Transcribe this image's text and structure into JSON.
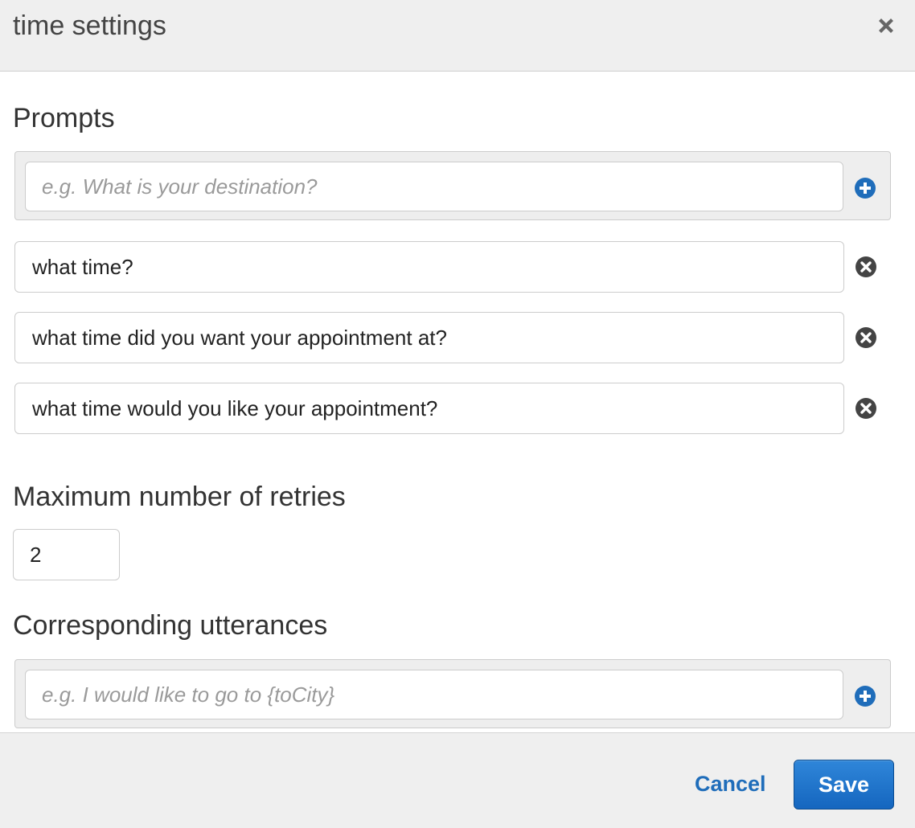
{
  "dialog": {
    "title": "time settings",
    "close_icon": "close-icon"
  },
  "prompts": {
    "heading": "Prompts",
    "new_prompt_placeholder": "e.g. What is your destination?",
    "add_icon": "plus-circle-icon",
    "remove_icon": "x-circle-icon",
    "items": [
      "what time?",
      "what time did you want your appointment at?",
      "what time would you like your appointment?"
    ]
  },
  "retries": {
    "heading": "Maximum number of retries",
    "value": "2"
  },
  "utterances": {
    "heading": "Corresponding utterances",
    "new_utterance_placeholder": "e.g. I would like to go to {toCity}",
    "add_icon": "plus-circle-icon"
  },
  "footer": {
    "cancel_label": "Cancel",
    "save_label": "Save"
  },
  "colors": {
    "accent": "#1f6dba",
    "save_button": "#1a70c8",
    "header_bg": "#efefef",
    "panel_bg": "#eeeeee",
    "remove_icon": "#444444"
  }
}
